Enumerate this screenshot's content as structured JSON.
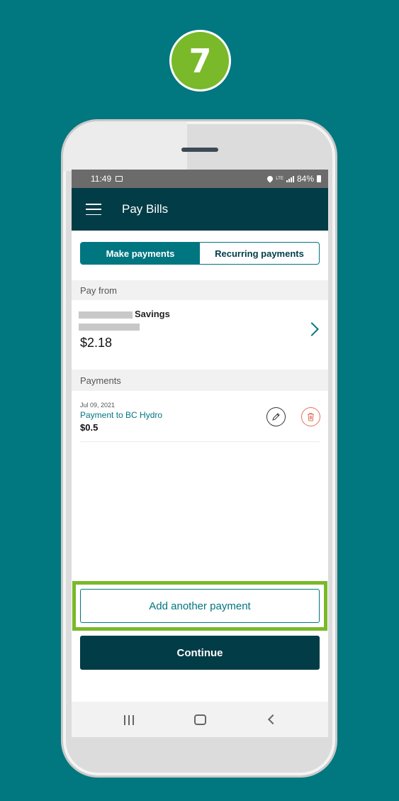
{
  "step": {
    "number": "7"
  },
  "status_bar": {
    "time": "11:49",
    "lte": "LTE",
    "battery": "84%"
  },
  "header": {
    "title": "Pay Bills"
  },
  "tabs": [
    {
      "label": "Make payments",
      "active": true
    },
    {
      "label": "Recurring payments",
      "active": false
    }
  ],
  "pay_from": {
    "section_label": "Pay from",
    "account_name": "Savings",
    "balance": "$2.18"
  },
  "payments": {
    "section_label": "Payments",
    "items": [
      {
        "date": "Jul 09, 2021",
        "description": "Payment to BC Hydro",
        "amount": "$0.5"
      }
    ]
  },
  "actions": {
    "add_label": "Add another payment",
    "continue_label": "Continue"
  },
  "colors": {
    "background": "#017780",
    "accent": "#007680",
    "header": "#023c47",
    "highlight": "#7ab929",
    "delete": "#e0705a"
  },
  "icons": [
    "image-icon",
    "location-icon",
    "signal-icon",
    "battery-icon",
    "menu-icon",
    "chevron-right-icon",
    "edit-icon",
    "trash-icon",
    "recent-apps-icon",
    "home-icon",
    "back-icon"
  ]
}
